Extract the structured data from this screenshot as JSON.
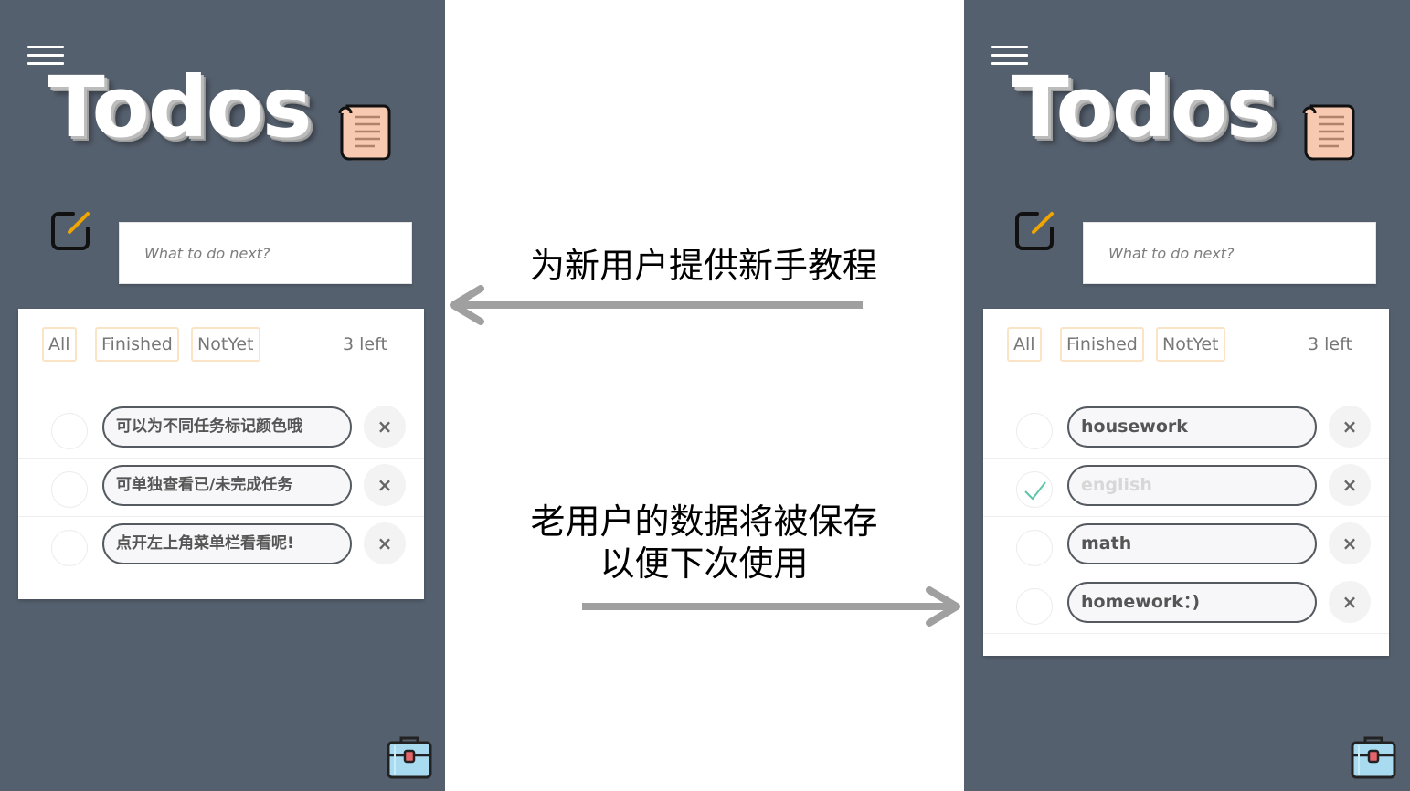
{
  "left_screen": {
    "app_title": "Todos",
    "input_placeholder": "What to do next?",
    "filters": {
      "all": "All",
      "finished": "Finished",
      "not_yet": "NotYet"
    },
    "remaining": "3 left",
    "todos": [
      {
        "text": "可以为不同任务标记颜色哦",
        "done": false
      },
      {
        "text": "可单独查看已/未完成任务",
        "done": false
      },
      {
        "text": "点开左上角菜单栏看看呢!",
        "done": false
      }
    ],
    "delete_glyph": "×"
  },
  "right_screen": {
    "app_title": "Todos",
    "input_placeholder": "What to do next?",
    "filters": {
      "all": "All",
      "finished": "Finished",
      "not_yet": "NotYet"
    },
    "remaining": "3 left",
    "todos": [
      {
        "text": "housework",
        "done": false
      },
      {
        "text": "english",
        "done": true
      },
      {
        "text": "math",
        "done": false
      },
      {
        "text": "homework：)",
        "done": false
      }
    ],
    "delete_glyph": "×"
  },
  "annotations": {
    "top_caption": "为新用户提供新手教程",
    "bottom_caption_line1": "老用户的数据将被保存",
    "bottom_caption_line2": "以便下次使用"
  },
  "colors": {
    "screen_bg": "#55606e",
    "filter_border": "#fbe3c5",
    "pencil_accent": "#f0a500",
    "check_accent": "#5ec4a8",
    "arrow": "#a0a0a0"
  },
  "icons": [
    "menu-icon",
    "scroll-icon",
    "edit-icon",
    "check-icon",
    "close-icon",
    "toolbox-icon",
    "arrow-left-icon",
    "arrow-right-icon"
  ]
}
